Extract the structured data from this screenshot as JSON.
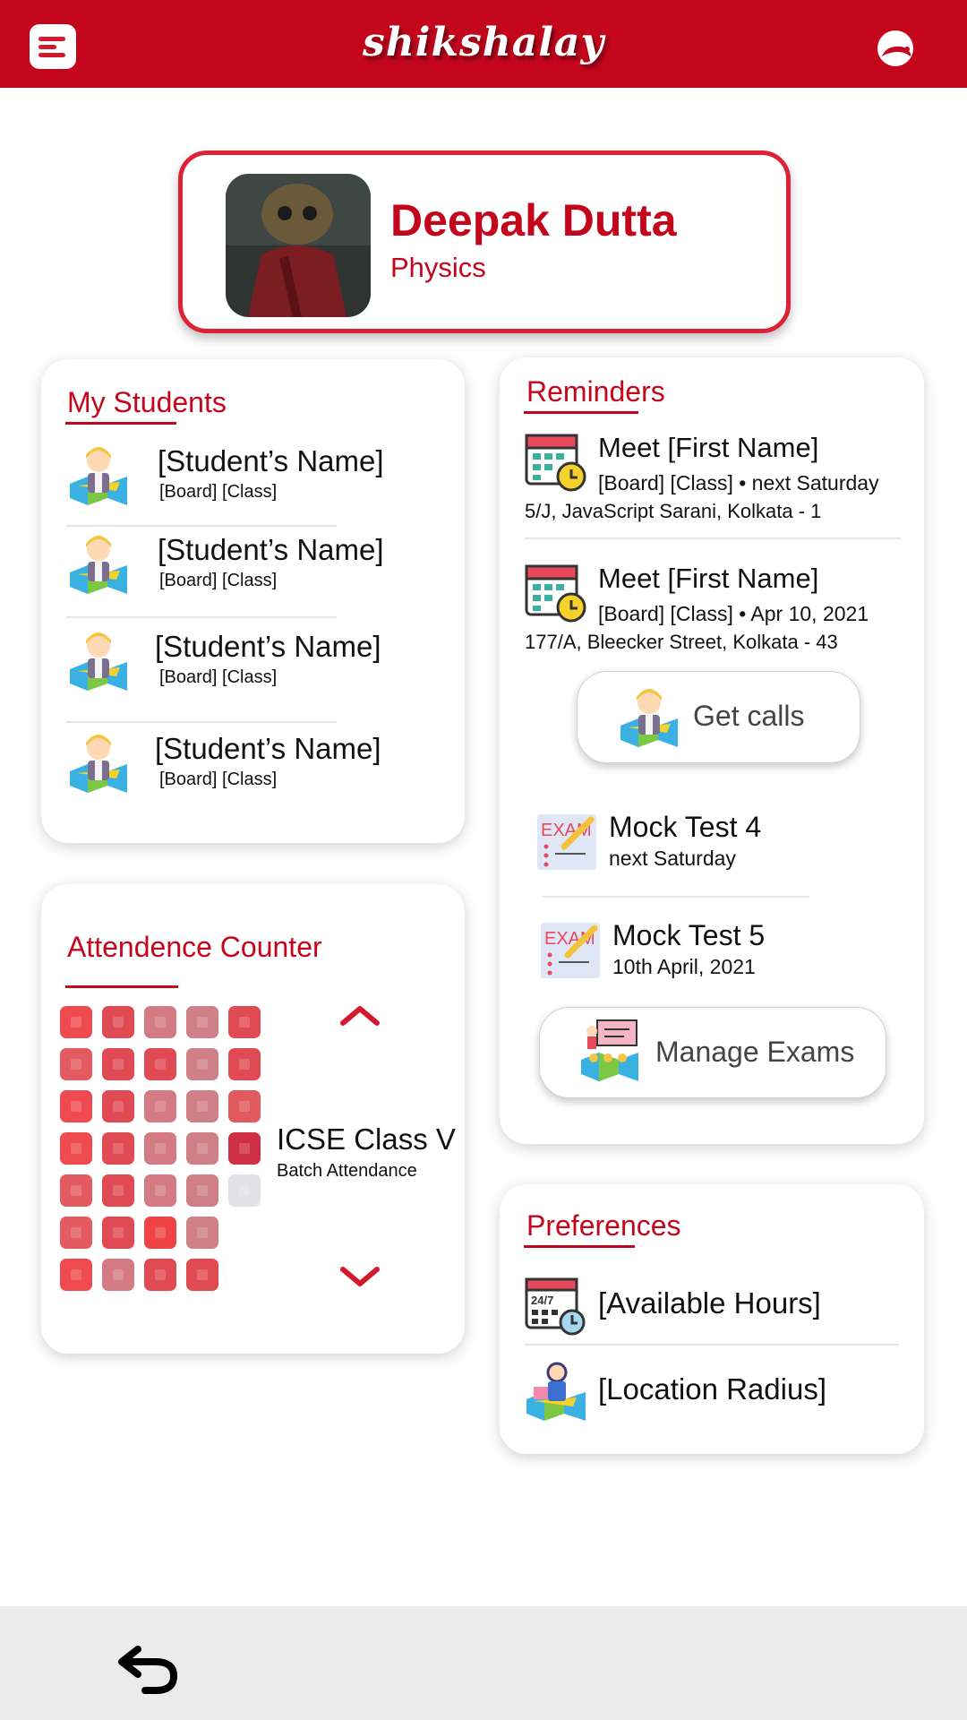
{
  "header": {
    "brand": "shikshalay",
    "menu_icon": "menu-icon",
    "profile_icon": "profile-face-icon",
    "bar_color": "#c4061d"
  },
  "profile": {
    "name": "Deepak Dutta",
    "subject": "Physics",
    "avatar_icon": "teacher-avatar-photo"
  },
  "students": {
    "title": "My Students",
    "items": [
      {
        "name": "[Student’s Name]",
        "meta": "[Board] [Class]"
      },
      {
        "name": "[Student’s Name]",
        "meta": "[Board] [Class]"
      },
      {
        "name": "[Student’s Name]",
        "meta": "[Board] [Class]"
      },
      {
        "name": "[Student’s Name]",
        "meta": "[Board] [Class]"
      }
    ]
  },
  "attendance": {
    "title": "Attendence Counter",
    "batch": "ICSE Class V",
    "subtitle": "Batch Attendance",
    "grid": [
      [
        "#ee4a4f",
        "#e04a52",
        "#d47a82",
        "#cf7f86",
        "#e04a52"
      ],
      [
        "#e35a60",
        "#e04a52",
        "#e04a52",
        "#cf7f86",
        "#e04a52"
      ],
      [
        "#ee4a4f",
        "#e04a52",
        "#d47a82",
        "#cf7f86",
        "#e05a5e"
      ],
      [
        "#ee4a4f",
        "#e04a52",
        "#d47a82",
        "#cf7f86",
        "#cf2f45"
      ],
      [
        "#e35a60",
        "#e04a52",
        "#d47a82",
        "#cf7f86",
        "#e2e2e6"
      ],
      [
        "#e35a60",
        "#e04a52",
        "#f04444",
        "#cf7f86"
      ],
      [
        "#ee4a4f",
        "#d47a82",
        "#e04a52",
        "#e04a52"
      ]
    ],
    "up_icon": "chevron-up-icon",
    "down_icon": "chevron-down-icon"
  },
  "reminders": {
    "title": "Reminders",
    "items": [
      {
        "title": "Meet [First Name]",
        "meta": "[Board] [Class] • next Saturday",
        "address": "5/J, JavaScript  Sarani, Kolkata - 1"
      },
      {
        "title": "Meet [First Name]",
        "meta": "[Board] [Class] • Apr 10, 2021",
        "address": "177/A, Bleecker Street, Kolkata - 43"
      }
    ],
    "get_calls_label": "Get calls",
    "exams": [
      {
        "title": "Mock Test 4",
        "meta": "next Saturday"
      },
      {
        "title": "Mock Test 5",
        "meta": "10th April, 2021"
      }
    ],
    "manage_exams_label": "Manage Exams"
  },
  "preferences": {
    "title": "Preferences",
    "items": [
      {
        "label": "[Available Hours]",
        "icon": "schedule-24-7-icon"
      },
      {
        "label": "[Location Radius]",
        "icon": "location-teacher-icon"
      }
    ]
  },
  "bottom": {
    "back_icon": "back-arrow-icon"
  }
}
